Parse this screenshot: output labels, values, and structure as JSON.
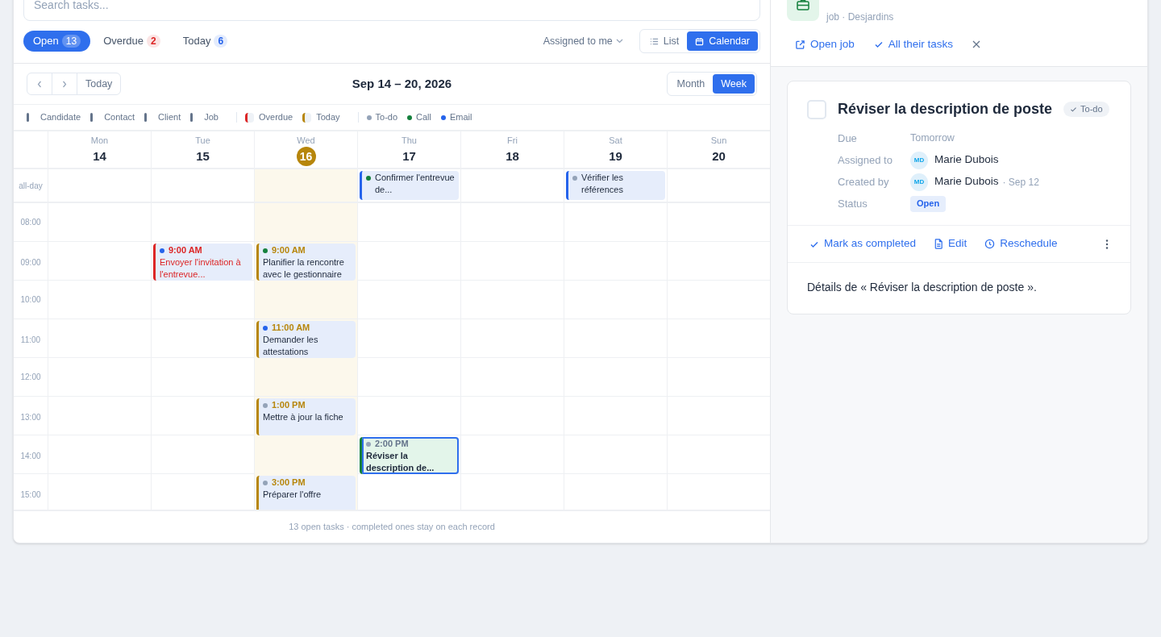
{
  "search": {
    "placeholder": "Search tasks..."
  },
  "filters": [
    {
      "label": "Open",
      "count": "13",
      "selected": true
    },
    {
      "label": "Overdue",
      "count": "2",
      "color": "#dc2626",
      "selected": false
    },
    {
      "label": "Today",
      "count": "6",
      "color": "#2563eb",
      "selected": false
    }
  ],
  "assignee_filter": "Assigned to me",
  "views": [
    {
      "label": "List",
      "kind": "list",
      "selected": false
    },
    {
      "label": "Calendar",
      "kind": "calendar",
      "selected": true
    }
  ],
  "calendar": {
    "today_button": "Today",
    "range": "Sep 14 – 20, 2026",
    "modes": [
      {
        "label": "Month",
        "selected": false
      },
      {
        "label": "Week",
        "selected": true
      }
    ],
    "legend": [
      {
        "items": [
          {
            "label": "Candidate",
            "kind": "bar",
            "color": "#64748b"
          },
          {
            "label": "Contact",
            "kind": "bar",
            "color": "#64748b"
          },
          {
            "label": "Client",
            "kind": "bar",
            "color": "#64748b"
          },
          {
            "label": "Job",
            "kind": "bar",
            "color": "#64748b"
          }
        ]
      },
      {
        "items": [
          {
            "label": "Overdue",
            "kind": "swatch",
            "color": "#dc2626"
          },
          {
            "label": "Today",
            "kind": "swatch",
            "color": "#b7860b"
          }
        ]
      },
      {
        "items": [
          {
            "label": "To-do",
            "kind": "dot",
            "color": "#94a3b8"
          },
          {
            "label": "Call",
            "kind": "dot",
            "color": "#15803d"
          },
          {
            "label": "Email",
            "kind": "dot",
            "color": "#2563eb"
          }
        ]
      }
    ],
    "days": [
      {
        "weekday": "Mon",
        "date": "14",
        "today": false
      },
      {
        "weekday": "Tue",
        "date": "15",
        "today": false
      },
      {
        "weekday": "Wed",
        "date": "16",
        "today": true
      },
      {
        "weekday": "Thu",
        "date": "17",
        "today": false
      },
      {
        "weekday": "Fri",
        "date": "18",
        "today": false
      },
      {
        "weekday": "Sat",
        "date": "19",
        "today": false
      },
      {
        "weekday": "Sun",
        "date": "20",
        "today": false
      }
    ],
    "all_day": {
      "label": "all-day",
      "cells": [
        null,
        null,
        null,
        {
          "title": "Confirmer l'entrevue de...",
          "kind": "upcoming",
          "color": "#15803d",
          "selected": false
        },
        null,
        {
          "title": "Vérifier les références",
          "kind": "upcoming",
          "color": "#94a3b8",
          "selected": false
        },
        null
      ]
    },
    "hours": [
      {
        "label": "08:00",
        "cells": [
          null,
          null,
          null,
          null,
          null,
          null,
          null
        ]
      },
      {
        "label": "09:00",
        "cells": [
          null,
          {
            "time": "9:00 AM",
            "title": "Envoyer l'invitation à l'entrevue...",
            "kind": "overdue",
            "color": "#2563eb",
            "selected": false
          },
          {
            "time": "9:00 AM",
            "title": "Planifier la rencontre avec le gestionnaire",
            "kind": "today",
            "color": "#15803d",
            "selected": false
          },
          null,
          null,
          null,
          null
        ]
      },
      {
        "label": "10:00",
        "cells": [
          null,
          null,
          null,
          null,
          null,
          null,
          null
        ]
      },
      {
        "label": "11:00",
        "cells": [
          null,
          null,
          {
            "time": "11:00 AM",
            "title": "Demander les attestations",
            "kind": "today",
            "color": "#2563eb",
            "selected": false
          },
          null,
          null,
          null,
          null
        ]
      },
      {
        "label": "12:00",
        "cells": [
          null,
          null,
          null,
          null,
          null,
          null,
          null
        ]
      },
      {
        "label": "13:00",
        "cells": [
          null,
          null,
          {
            "time": "1:00 PM",
            "title": "Mettre à jour la fiche",
            "kind": "today",
            "color": "#94a3b8",
            "selected": false
          },
          null,
          null,
          null,
          null
        ]
      },
      {
        "label": "14:00",
        "cells": [
          null,
          null,
          null,
          {
            "time": "2:00 PM",
            "title": "Réviser la description de...",
            "kind": "upcoming",
            "color": "#94a3b8",
            "selected": true
          },
          null,
          null,
          null
        ]
      },
      {
        "label": "15:00",
        "cells": [
          null,
          null,
          {
            "time": "3:00 PM",
            "title": "Préparer l'offre",
            "kind": "today",
            "color": "#94a3b8",
            "selected": false
          },
          null,
          null,
          null,
          null
        ]
      }
    ],
    "footer": "13 open tasks · completed ones stay on each record"
  },
  "record": {
    "subtitle": "job · Desjardins",
    "actions": [
      {
        "label": "Open job",
        "kind": "external"
      },
      {
        "label": "All their tasks",
        "kind": "check"
      }
    ]
  },
  "task": {
    "checked": false,
    "title": "Réviser la description de poste",
    "type": "To-do",
    "fields": [
      {
        "label": "Due",
        "kind": "text",
        "value": "Tomorrow"
      },
      {
        "label": "Assigned to",
        "kind": "person",
        "initials": "MD",
        "value": "Marie Dubois"
      },
      {
        "label": "Created by",
        "kind": "person",
        "initials": "MD",
        "value": "Marie Dubois",
        "note": "· Sep 12"
      },
      {
        "label": "Status",
        "kind": "badge",
        "value": "Open"
      }
    ],
    "actions": [
      {
        "label": "Mark as completed",
        "kind": "check"
      },
      {
        "label": "Edit",
        "kind": "edit"
      },
      {
        "label": "Reschedule",
        "kind": "clock"
      }
    ],
    "description": "Détails de « Réviser la description de poste »."
  }
}
